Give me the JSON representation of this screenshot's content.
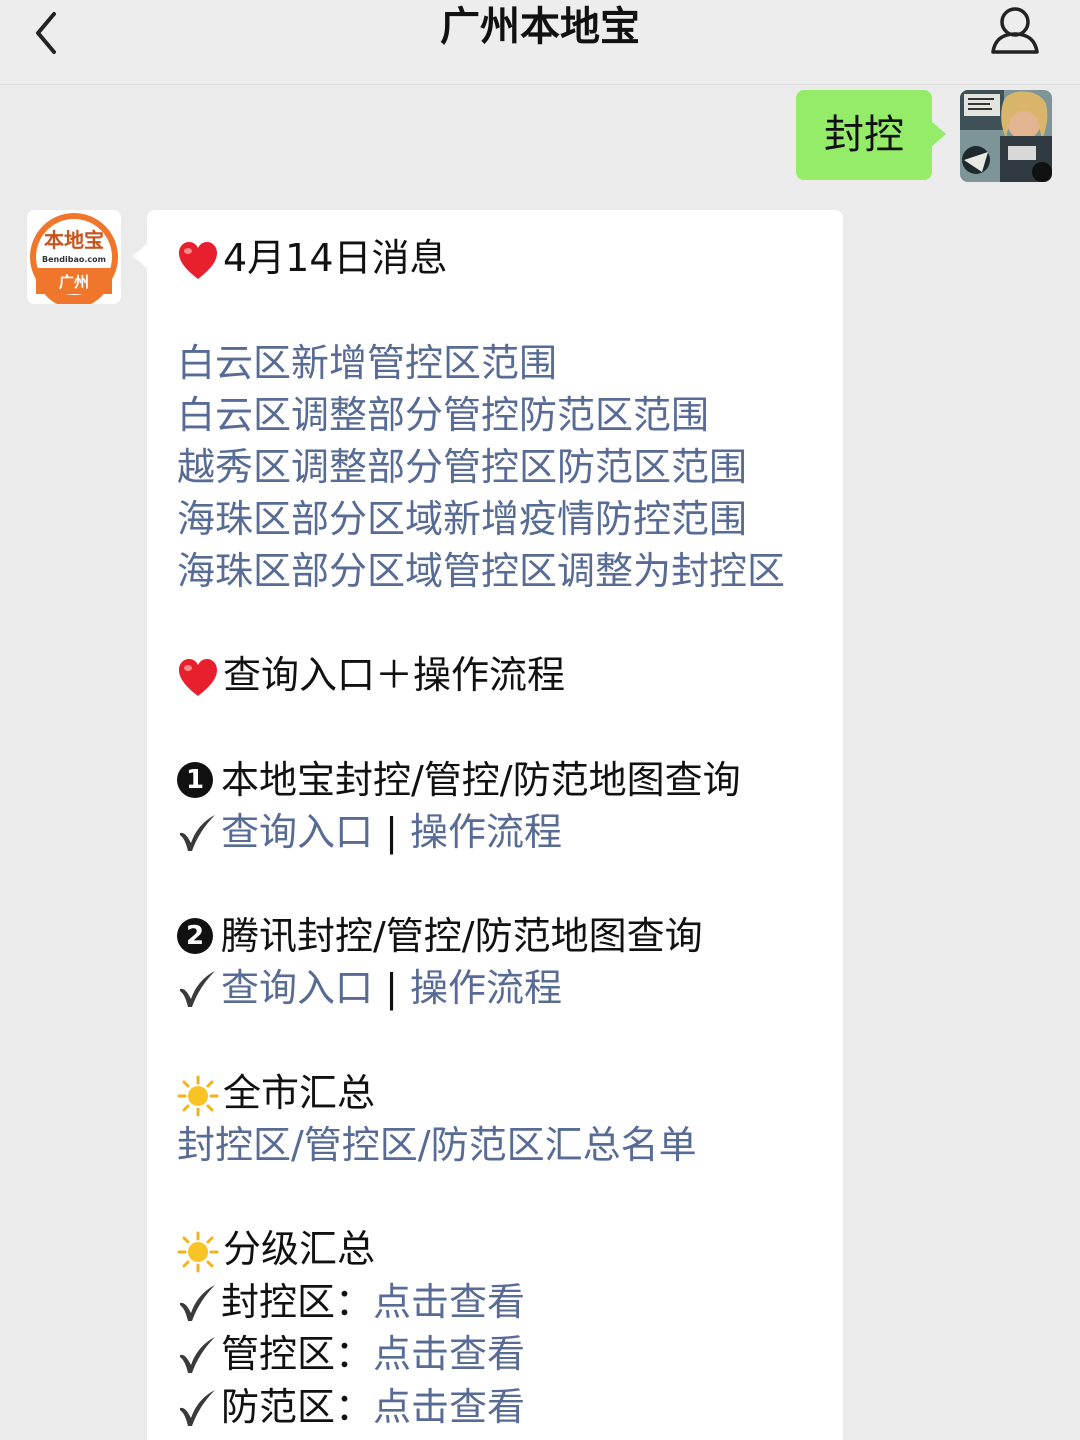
{
  "header": {
    "title": "广州本地宝",
    "back_icon": "chevron-left-icon",
    "profile_icon": "person-icon"
  },
  "outgoing": {
    "text": "封控"
  },
  "bot": {
    "logo_title": "本地宝",
    "logo_domain": "Bendibao.com",
    "logo_city": "广州"
  },
  "message": {
    "date_line": "4月14日消息",
    "links": [
      "白云区新增管控区范围",
      "白云区调整部分管控防范区范围",
      "越秀区调整部分管控区防范区范围",
      "海珠区部分区域新增疫情防控范围",
      "海珠区部分区域管控区调整为封控区"
    ],
    "query_heading": "查询入口＋操作流程",
    "item1_title": "本地宝封控/管控/防范地图查询",
    "item1_number": "1",
    "item2_title": "腾讯封控/管控/防范地图查询",
    "item2_number": "2",
    "entry_link": "查询入口",
    "separator": " | ",
    "process_link": "操作流程",
    "city_summary_heading": "全市汇总",
    "city_summary_link": "封控区/管控区/防范区汇总名单",
    "level_summary_heading": "分级汇总",
    "levels": [
      {
        "label": "封控区：",
        "link": "点击查看"
      },
      {
        "label": "管控区：",
        "link": "点击查看"
      },
      {
        "label": "防范区：",
        "link": "点击查看"
      }
    ]
  },
  "colors": {
    "link": "#576b95",
    "outgoing_bubble": "#95ec69",
    "logo_orange": "#f0762c"
  }
}
